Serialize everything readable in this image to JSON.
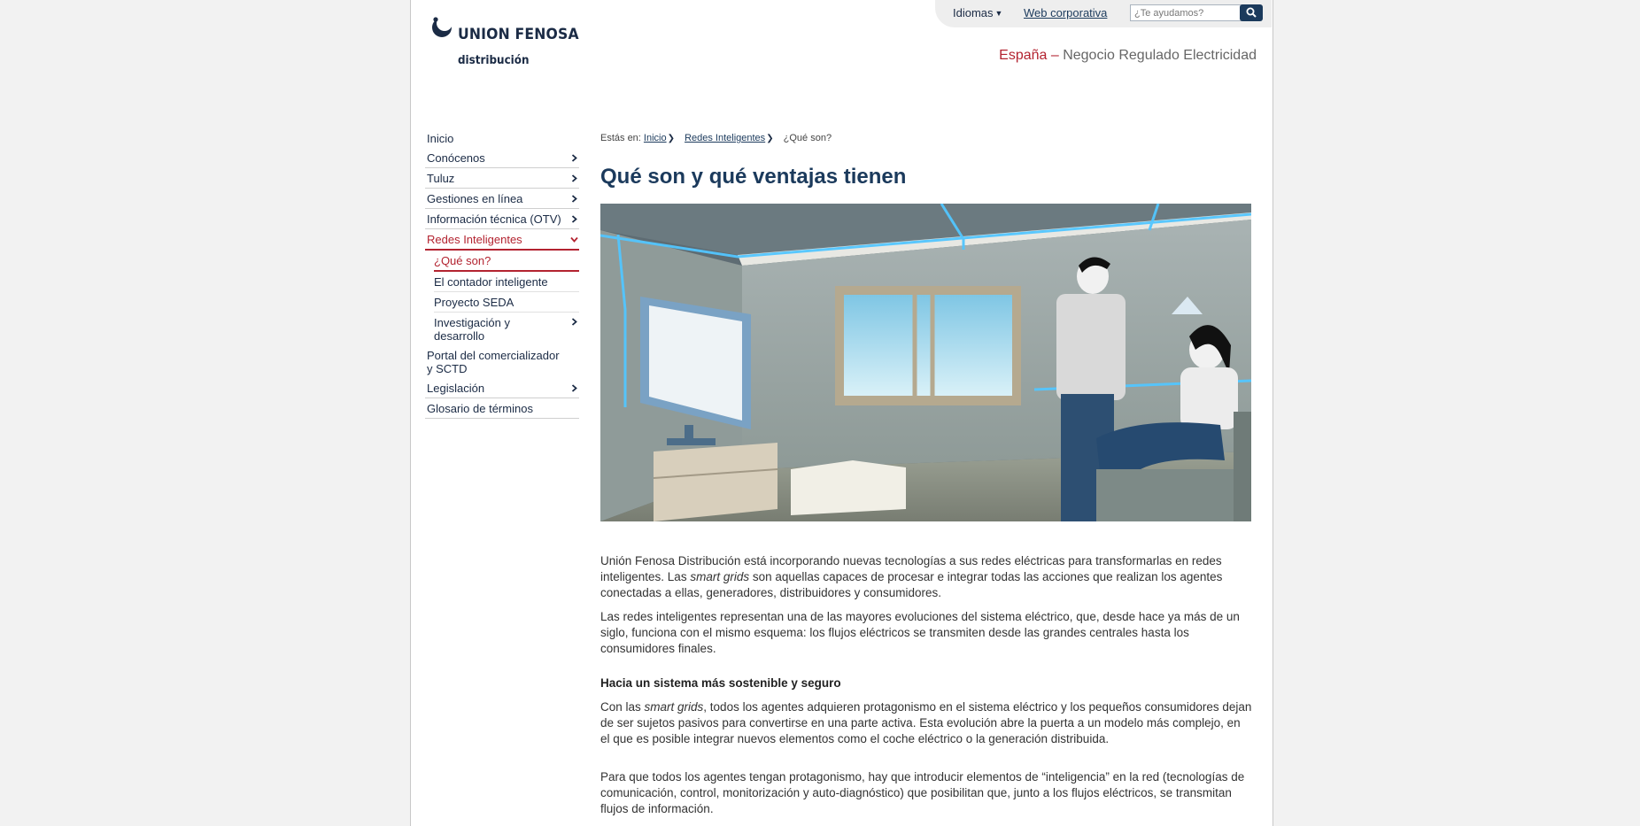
{
  "header": {
    "logo_name": "UNION FENOSA",
    "logo_sub": "distribución",
    "languages_label": "Idiomas",
    "corporate_link": "Web corporativa",
    "search_placeholder": "¿Te ayudamos?",
    "region_country": "España",
    "region_separator": " – ",
    "region_text": "Negocio Regulado Electricidad"
  },
  "sidebar": {
    "items": [
      {
        "label": "Inicio"
      },
      {
        "label": "Conócenos"
      },
      {
        "label": "Tuluz"
      },
      {
        "label": "Gestiones en línea"
      },
      {
        "label": "Información técnica (OTV)"
      },
      {
        "label": "Redes Inteligentes"
      },
      {
        "label": "Portal del comercializador y SCTD"
      },
      {
        "label": "Legislación"
      },
      {
        "label": "Glosario de términos"
      }
    ],
    "subitems": [
      {
        "label": "¿Qué son?"
      },
      {
        "label": "El contador inteligente"
      },
      {
        "label": "Proyecto SEDA"
      },
      {
        "label": "Investigación y desarrollo"
      }
    ]
  },
  "breadcrumb": {
    "prefix": "Estás en:",
    "items": [
      "Inicio",
      "Redes Inteligentes"
    ],
    "current": "¿Qué son?"
  },
  "main": {
    "title": "Qué son y qué ventajas tienen",
    "p1_a": "Unión Fenosa Distribución está incorporando nuevas tecnologías a sus redes eléctricas para transformarlas en redes inteligentes. Las ",
    "p1_em": "smart grids",
    "p1_b": " son aquellas capaces de procesar e integrar todas las acciones que realizan los agentes conectadas a ellas, generadores, distribuidores y consumidores.",
    "p2": "Las redes inteligentes representan una de las mayores evoluciones del sistema eléctrico, que, desde hace ya más de un siglo, funciona con el mismo esquema: los flujos eléctricos se transmiten desde las grandes centrales hasta los consumidores finales.",
    "h2": "Hacia un sistema más sostenible y seguro",
    "p3_a": "Con las ",
    "p3_em": "smart grids",
    "p3_b": ", todos los agentes adquieren protagonismo en el sistema eléctrico y los pequeños consumidores dejan de ser sujetos pasivos para convertirse en una parte activa. Esta evolución abre la puerta a un modelo más complejo, en el que es posible integrar nuevos elementos como el coche eléctrico o la generación distribuida.",
    "p4": "Para que todos los agentes tengan protagonismo, hay que introducir elementos de “inteligencia” en la red (tecnologías de comunicación, control, monitorización y auto-diagnóstico) que posibilitan que, junto a los flujos eléctricos, se transmitan flujos de información."
  },
  "colors": {
    "brand": "#1b2b45",
    "accent_red": "#b32330",
    "title_blue": "#1b3a5c"
  }
}
